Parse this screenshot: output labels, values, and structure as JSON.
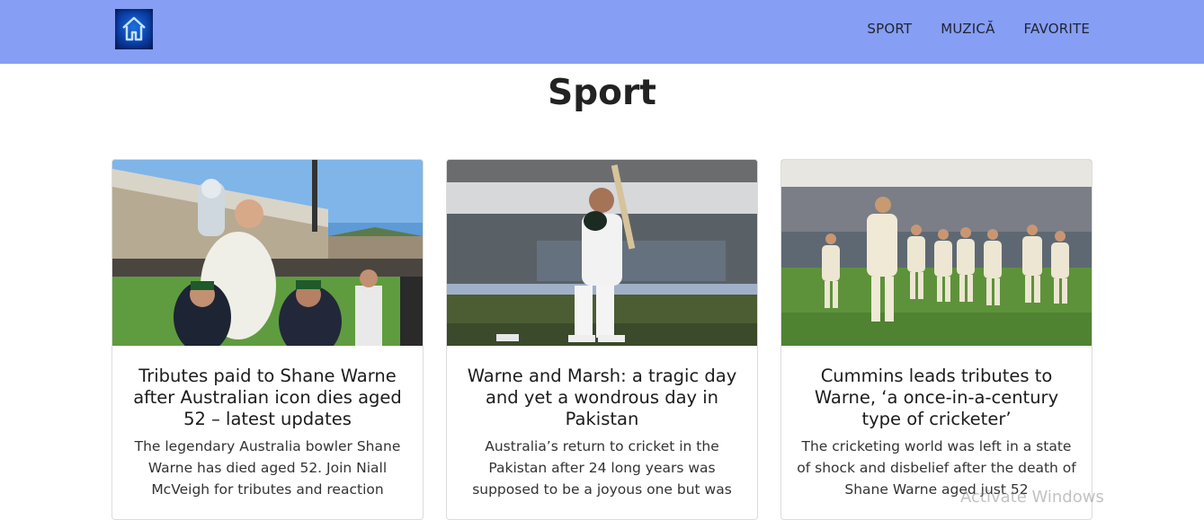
{
  "nav": {
    "logo_icon": "home-icon",
    "links": [
      {
        "label": "SPORT"
      },
      {
        "label": "MUZICĂ"
      },
      {
        "label": "FAVORITE"
      }
    ]
  },
  "page": {
    "title": "Sport"
  },
  "cards": [
    {
      "title": "Tributes paid to Shane Warne after Australian icon dies aged 52 – latest updates",
      "text": "The legendary Australia bowler Shane Warne has died aged 52. Join Niall McVeigh for tributes and reaction",
      "image": "cricketer-celebrating-with-trophy"
    },
    {
      "title": "Warne and Marsh: a tragic day and yet a wondrous day in Pakistan",
      "text": "Australia’s return to cricket in the Pakistan after 24 long years was supposed to be a joyous one but was",
      "image": "batsman-raising-helmet"
    },
    {
      "title": "Cummins leads tributes to Warne, ‘a once-in-a-century type of cricketer’",
      "text": "The cricketing world was left in a state of shock and disbelief after the death of Shane Warne aged just 52",
      "image": "team-walking-off-field"
    }
  ],
  "overlay": {
    "watermark": "Activate Windows"
  },
  "colors": {
    "navbar_bg": "#869ef3",
    "page_bg": "#ffffff"
  }
}
